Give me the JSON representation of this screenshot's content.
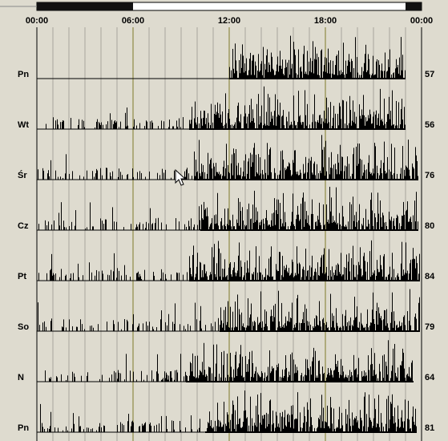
{
  "chart_data": {
    "type": "bar",
    "x_range_hours": [
      0,
      24
    ],
    "x_tick_labels": [
      "00:00",
      "06:00",
      "12:00",
      "18:00",
      "00:00"
    ],
    "gridlines": "hourly",
    "highlight_gridlines_hours": [
      6,
      12,
      18
    ],
    "rows": [
      {
        "day": "Pn",
        "count": "57",
        "activity_start": 12.0,
        "activity_end": 23.0,
        "scattered_before": false
      },
      {
        "day": "Wt",
        "count": "56",
        "activity_start": 9.5,
        "activity_end": 23.0,
        "scattered_before": true
      },
      {
        "day": "Śr",
        "count": "76",
        "activity_start": 9.8,
        "activity_end": 23.8,
        "scattered_before": true
      },
      {
        "day": "Cz",
        "count": "80",
        "activity_start": 10.2,
        "activity_end": 23.8,
        "scattered_before": true
      },
      {
        "day": "Pt",
        "count": "84",
        "activity_start": 9.5,
        "activity_end": 23.9,
        "scattered_before": true
      },
      {
        "day": "So",
        "count": "79",
        "activity_start": 11.4,
        "activity_end": 23.9,
        "scattered_before": true
      },
      {
        "day": "N",
        "count": "64",
        "activity_start": 9.3,
        "activity_end": 23.5,
        "scattered_before": true
      },
      {
        "day": "Pn",
        "count": "81",
        "activity_start": 10.5,
        "activity_end": 23.7,
        "scattered_before": true
      }
    ],
    "title": "",
    "xlabel": "",
    "ylabel": ""
  },
  "time_bar": {
    "filled_ranges_hours": [
      [
        0,
        6
      ],
      [
        23,
        24
      ]
    ]
  },
  "colors": {
    "background": "#dedbcf",
    "gridline": "#a8a69c",
    "highlight_gridline": "#7f7a2a",
    "bars": "#000000",
    "axis": "#000000"
  },
  "cursor": "mouse-pointer-icon"
}
